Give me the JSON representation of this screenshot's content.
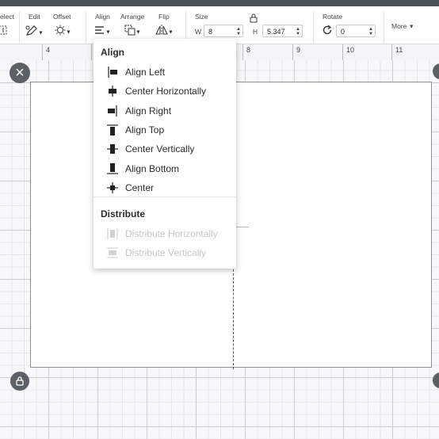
{
  "toolbar": {
    "select": {
      "label": "elect"
    },
    "edit": {
      "label": "Edit"
    },
    "offset": {
      "label": "Offset"
    },
    "align": {
      "label": "Align"
    },
    "arrange": {
      "label": "Arrange"
    },
    "flip": {
      "label": "Flip"
    },
    "size": {
      "label": "Size",
      "w_label": "W",
      "w_value": "8",
      "h_label": "H",
      "h_value": "5.347"
    },
    "rotate": {
      "label": "Rotate",
      "value": "0"
    },
    "more": {
      "label": "More"
    }
  },
  "ruler": {
    "numbers": [
      "4",
      "8",
      "9",
      "10",
      "11"
    ]
  },
  "align_menu": {
    "heading": "Align",
    "items": [
      {
        "label": "Align Left",
        "icon": "align-left-icon",
        "enabled": true
      },
      {
        "label": "Center Horizontally",
        "icon": "center-horizontally-icon",
        "enabled": true
      },
      {
        "label": "Align Right",
        "icon": "align-right-icon",
        "enabled": true
      },
      {
        "label": "Align Top",
        "icon": "align-top-icon",
        "enabled": true
      },
      {
        "label": "Center Vertically",
        "icon": "center-vertically-icon",
        "enabled": true
      },
      {
        "label": "Align Bottom",
        "icon": "align-bottom-icon",
        "enabled": true
      },
      {
        "label": "Center",
        "icon": "center-icon",
        "enabled": true
      }
    ],
    "distribute_heading": "Distribute",
    "distribute_items": [
      {
        "label": "Distribute Horizontally",
        "icon": "distribute-horizontally-icon",
        "enabled": false
      },
      {
        "label": "Distribute Vertically",
        "icon": "distribute-vertically-icon",
        "enabled": false
      }
    ]
  },
  "colors": {
    "toolbar_top": "#4a5259",
    "canvas_border": "#8a8f94",
    "control_button": "#5a6066",
    "disabled_text": "#c4c7ca"
  }
}
